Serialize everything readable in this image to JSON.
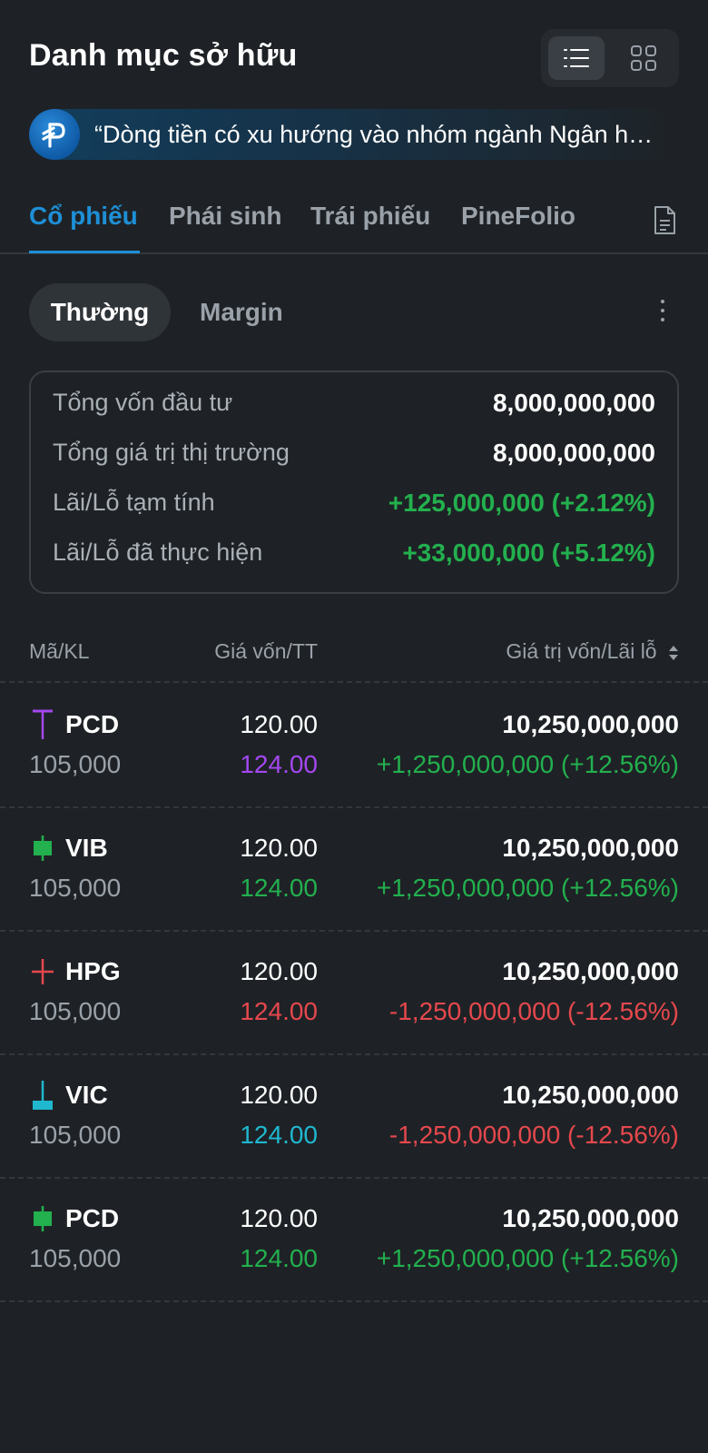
{
  "header": {
    "title": "Danh mục sở hữu",
    "view_modes": [
      "list-icon",
      "grid-icon"
    ],
    "active_view": "list"
  },
  "news": {
    "text": "“Dòng tiền có xu hướng vào nhóm ngành Ngân hàng"
  },
  "tabs": [
    {
      "label": "Cổ phiếu",
      "active": true
    },
    {
      "label": "Phái sinh",
      "active": false
    },
    {
      "label": "Trái phiếu",
      "active": false
    },
    {
      "label": "PineFolio",
      "active": false
    }
  ],
  "subtabs": [
    {
      "label": "Thường",
      "active": true
    },
    {
      "label": "Margin",
      "active": false
    }
  ],
  "summary": [
    {
      "label": "Tổng vốn đầu tư",
      "value": "8,000,000,000",
      "tone": "white"
    },
    {
      "label": "Tổng giá trị thị trường",
      "value": "8,000,000,000",
      "tone": "white"
    },
    {
      "label": "Lãi/Lỗ tạm tính",
      "value": "+125,000,000 (+2.12%)",
      "tone": "green"
    },
    {
      "label": "Lãi/Lỗ đã thực hiện",
      "value": "+33,000,000 (+5.12%)",
      "tone": "green"
    }
  ],
  "table": {
    "headers": {
      "symbol_qty": "Mã/KL",
      "price": "Giá vốn/TT",
      "value_pnl": "Giá trị vốn/Lãi lỗ"
    },
    "rows": [
      {
        "ticker": "PCD",
        "qty": "105,000",
        "cost_price": "120.00",
        "market_price": "124.00",
        "price_tone": "purple",
        "value": "10,250,000,000",
        "pnl": "+1,250,000,000 (+12.56%)",
        "pnl_tone": "green",
        "candle": "ceiling",
        "candle_color": "#a447f0"
      },
      {
        "ticker": "VIB",
        "qty": "105,000",
        "cost_price": "120.00",
        "market_price": "124.00",
        "price_tone": "green",
        "value": "10,250,000,000",
        "pnl": "+1,250,000,000 (+12.56%)",
        "pnl_tone": "green",
        "candle": "body",
        "candle_color": "#23b04e"
      },
      {
        "ticker": "HPG",
        "qty": "105,000",
        "cost_price": "120.00",
        "market_price": "124.00",
        "price_tone": "red",
        "value": "10,250,000,000",
        "pnl": "-1,250,000,000 (-12.56%)",
        "pnl_tone": "red",
        "candle": "cross",
        "candle_color": "#e5484d"
      },
      {
        "ticker": "VIC",
        "qty": "105,000",
        "cost_price": "120.00",
        "market_price": "124.00",
        "price_tone": "cyan",
        "value": "10,250,000,000",
        "pnl": "-1,250,000,000 (-12.56%)",
        "pnl_tone": "red",
        "candle": "floor",
        "candle_color": "#1fb8cf"
      },
      {
        "ticker": "PCD",
        "qty": "105,000",
        "cost_price": "120.00",
        "market_price": "124.00",
        "price_tone": "green",
        "value": "10,250,000,000",
        "pnl": "+1,250,000,000 (+12.56%)",
        "pnl_tone": "green",
        "candle": "body",
        "candle_color": "#23b04e"
      }
    ]
  },
  "colors": {
    "background": "#1e2226",
    "accent": "#1e8fd6",
    "up": "#23b04e",
    "down": "#e5484d",
    "ceiling": "#a447f0",
    "floor": "#1fb8cf"
  }
}
